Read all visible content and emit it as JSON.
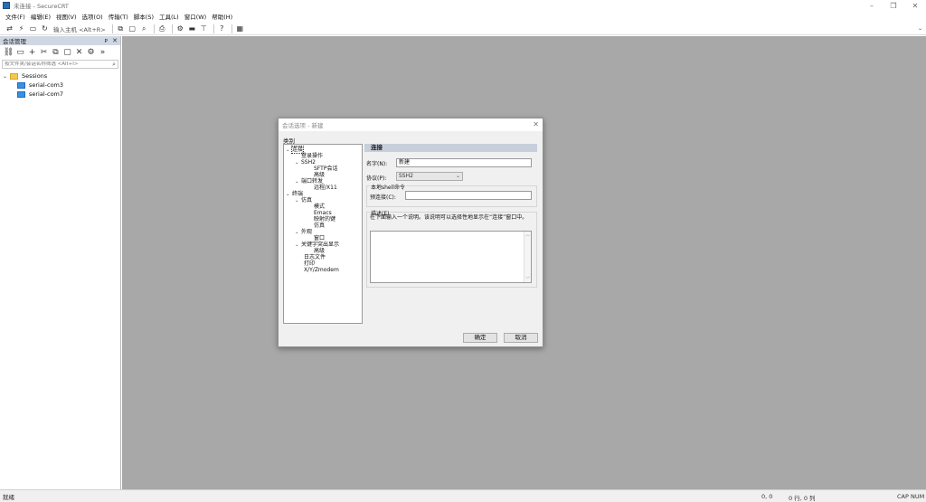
{
  "window": {
    "title": "未连接 - SecureCRT",
    "minimize": "–",
    "maximize": "❐",
    "close": "✕"
  },
  "menu": [
    "文件(F)",
    "编辑(E)",
    "视图(V)",
    "选项(O)",
    "传输(T)",
    "脚本(S)",
    "工具(L)",
    "窗口(W)",
    "帮助(H)"
  ],
  "toolbar": {
    "host_prompt": "输入主机 <Alt+R>"
  },
  "session_manager": {
    "title": "会话管理",
    "pin": "ᴘ",
    "close": "✕",
    "filter_placeholder": "按文件夹/会话名称筛选 <Alt+I>",
    "root": "Sessions",
    "sessions": [
      "serial-com3",
      "serial-com7"
    ]
  },
  "status": {
    "ready": "就绪",
    "cursor": "0, 0",
    "rowscols": "0 行, 0 列",
    "cap": "CAP",
    "num": "NUM"
  },
  "dialog": {
    "title": "会话选项 - 新建",
    "close": "✕",
    "category_label": "类别",
    "categories": {
      "connection": "连接",
      "login_actions": "登录操作",
      "ssh2": "SSH2",
      "sftp_session": "SFTP会话",
      "advanced1": "高级",
      "port_forwarding": "端口转发",
      "remote_x11": "远程/X11",
      "terminal": "终端",
      "emulation": "仿真",
      "modes": "模式",
      "emacs": "Emacs",
      "mapped_keys": "映射的键",
      "advanced2": "仿真",
      "appearance": "外观",
      "window": "窗口",
      "keyword_highlight": "关键字突出显示",
      "advanced3": "高级",
      "log_file": "日志文件",
      "printing": "打印",
      "xyz_modem": "X/Y/Zmodem"
    },
    "section_title": "连接",
    "name_label": "名字(N):",
    "name_value": "新建",
    "protocol_label": "协议(P):",
    "protocol_value": "SSH2",
    "local_shell_label": "本地shell命令",
    "preconnect_label": "预连接(C):",
    "preconnect_value": "",
    "description_label": "描述(E)",
    "description_hint": "在下面输入一个说明。该说明可以选择性地显示在“连接”窗口中。",
    "ok": "确定",
    "cancel": "取消"
  }
}
